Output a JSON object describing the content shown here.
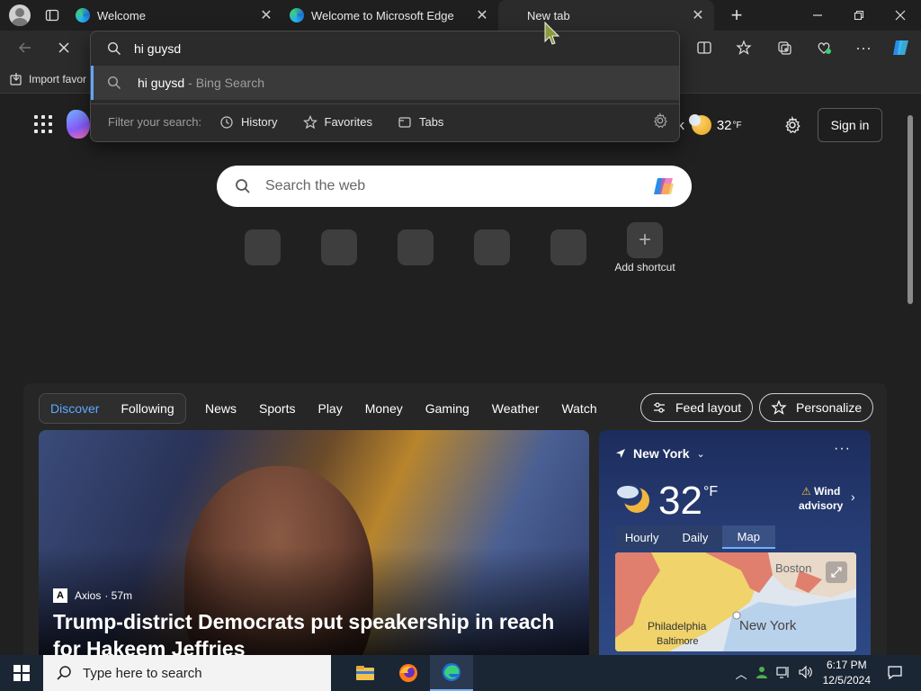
{
  "tabs": [
    {
      "title": "Welcome"
    },
    {
      "title": "Welcome to Microsoft Edge"
    },
    {
      "title": "New tab"
    }
  ],
  "omnibox": {
    "value": "hi guysd",
    "suggestion": {
      "main": "hi guysd",
      "sub": "- Bing Search"
    },
    "filter_label": "Filter your search:",
    "filters": [
      "History",
      "Favorites",
      "Tabs"
    ]
  },
  "favorites_bar": {
    "import_label": "Import favor"
  },
  "header": {
    "city_fragment": "ork",
    "temperature": "32",
    "temp_unit": "°F",
    "signin_label": "Sign in"
  },
  "search": {
    "placeholder": "Search the web"
  },
  "shortcuts": {
    "add_label": "Add shortcut"
  },
  "feed": {
    "pills": [
      "Discover",
      "Following"
    ],
    "nav": [
      "News",
      "Sports",
      "Play",
      "Money",
      "Gaming",
      "Weather",
      "Watch"
    ],
    "feed_layout_label": "Feed layout",
    "personalize_label": "Personalize"
  },
  "hero": {
    "source": "Axios",
    "age": "· 57m",
    "headline": "Trump-district Democrats put speakership in reach for Hakeem Jeffries"
  },
  "weather_card": {
    "location": "New York",
    "more": "···",
    "temp": "32",
    "unit": "°F",
    "advisory_line1": "Wind",
    "advisory_line2": "advisory",
    "tabs": [
      "Hourly",
      "Daily",
      "Map"
    ],
    "active_tab": "Map",
    "map_labels": [
      "Boston",
      "Philadelphia",
      "New York",
      "Baltimore"
    ]
  },
  "taskbar": {
    "search_placeholder": "Type here to search",
    "time": "6:17 PM",
    "date": "12/5/2024"
  }
}
